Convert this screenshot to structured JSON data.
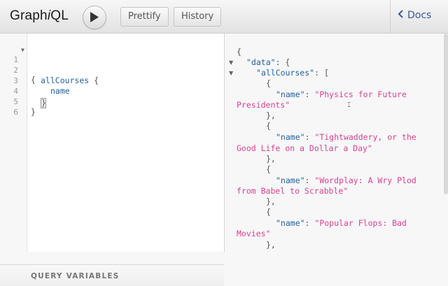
{
  "app": {
    "title_prefix": "Graph",
    "title_italic": "i",
    "title_suffix": "QL"
  },
  "toolbar": {
    "run_label": "Run",
    "prettify_label": "Prettify",
    "history_label": "History",
    "docs_label": "Docs"
  },
  "editor": {
    "line_numbers": [
      "1",
      "2",
      "3",
      "4",
      "5",
      "6"
    ],
    "line1": "{",
    "line2_field": "allCourses",
    "line2_brace": " {",
    "line3": "name",
    "line4": "}",
    "line5": "}"
  },
  "variables": {
    "label": "QUERY VARIABLES"
  },
  "result": {
    "open": "{",
    "data_key": "\"data\"",
    "data_sep": ": {",
    "all_key": "\"allCourses\"",
    "all_sep": ": [",
    "obj_open": "{",
    "obj_close": "},",
    "name_key": "\"name\"",
    "colon": ": ",
    "items": [
      {
        "part1": "\"Physics for Future",
        "part2": "Presidents\""
      },
      {
        "part1": "\"Tightwaddery, or the",
        "part2": "Good Life on a Dollar a Day\""
      },
      {
        "part1": "\"Wordplay: A Wry Plod",
        "part2": "from Babel to Scrabble\""
      },
      {
        "part1": "\"Popular Flops: Bad",
        "part2": "Movies\""
      }
    ]
  },
  "colors": {
    "field": "#1f61a0",
    "string": "#d64292",
    "docs_link": "#3b5998"
  },
  "icons": [
    "play-icon",
    "chevron-left-icon",
    "fold-arrow-icon"
  ]
}
